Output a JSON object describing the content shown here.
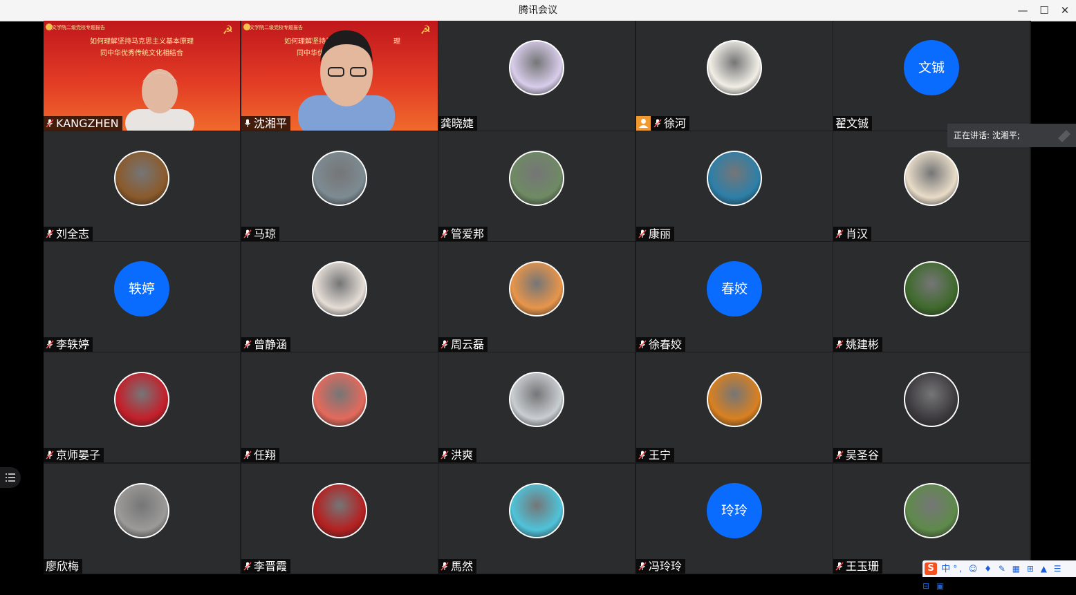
{
  "window": {
    "title": "腾讯会议",
    "controls": {
      "minimize": "—",
      "maximize": "☐",
      "close": "✕"
    }
  },
  "speaking": {
    "label": "正在讲话: 沈湘平;"
  },
  "slide": {
    "header": "文学院二级党校专题报告",
    "line1": "如何理解坚持马克思主义基本原理",
    "line2": "同中华优秀传统文化相结合",
    "line1_partial": "如何理解坚持马克",
    "line1_tail": "理",
    "line2_partial": "同中华优秀传"
  },
  "participants": [
    {
      "name": "KANGZHEN",
      "mic": "muted",
      "video": "slide"
    },
    {
      "name": "沈湘平",
      "mic": "on",
      "video": "slide"
    },
    {
      "name": "龚晓婕",
      "mic": "none",
      "avatar": "pastel-bird-illustration",
      "color": "#d8cdeb"
    },
    {
      "name": "徐河",
      "mic": "muted",
      "badge": "user-icon",
      "avatar": "cartoon-sprout-character",
      "color": "#f1eee6"
    },
    {
      "name": "翟文铖",
      "mic": "none",
      "avatar_text": "文铖"
    },
    {
      "name": "刘全志",
      "mic": "muted",
      "avatar": "horse-photo",
      "color": "#8b5a2b"
    },
    {
      "name": "马琼",
      "mic": "muted",
      "avatar": "mountain-portrait-photo",
      "color": "#7d8b92"
    },
    {
      "name": "管爱邦",
      "mic": "muted",
      "avatar": "river-boat-photo",
      "color": "#6f8a64"
    },
    {
      "name": "康丽",
      "mic": "muted",
      "avatar": "blue-art-figure",
      "color": "#2d7fa8"
    },
    {
      "name": "肖汉",
      "mic": "muted",
      "avatar": "anime-character",
      "color": "#e9dcc8"
    },
    {
      "name": "李轶婷",
      "mic": "muted",
      "avatar_text": "轶婷"
    },
    {
      "name": "曾静涵",
      "mic": "muted",
      "avatar": "woman-portrait",
      "color": "#e5ddd6"
    },
    {
      "name": "周云磊",
      "mic": "muted",
      "avatar": "cartoon-man-bookshelf",
      "color": "#e8954a"
    },
    {
      "name": "徐春姣",
      "mic": "muted",
      "avatar_text": "春姣"
    },
    {
      "name": "姚建彬",
      "mic": "muted",
      "avatar": "green-landscape-photo",
      "color": "#3f6a2c"
    },
    {
      "name": "京师晏子",
      "mic": "muted",
      "avatar": "red-lantern-poster",
      "color": "#c41f2a"
    },
    {
      "name": "任翔",
      "mic": "muted",
      "avatar": "sailboat-sunset",
      "color": "#e36a5c"
    },
    {
      "name": "洪爽",
      "mic": "muted",
      "avatar": "lighthouse-photo",
      "color": "#c9ced3"
    },
    {
      "name": "王宁",
      "mic": "muted",
      "avatar": "fire-explosion",
      "color": "#d98020"
    },
    {
      "name": "吴圣谷",
      "mic": "muted",
      "avatar": "man-portrait",
      "color": "#3d3a3e"
    },
    {
      "name": "廖欣梅",
      "mic": "none",
      "avatar": "woman-grayscale-photo",
      "color": "#9c9a98"
    },
    {
      "name": "李晋霞",
      "mic": "muted",
      "avatar": "red-black-artwork",
      "color": "#b52020"
    },
    {
      "name": "馬然",
      "mic": "muted",
      "avatar": "zebra-illustration",
      "color": "#4fc3d9"
    },
    {
      "name": "冯玲玲",
      "mic": "muted",
      "avatar_text": "玲玲"
    },
    {
      "name": "王玉珊",
      "mic": "muted",
      "avatar": "village-photo",
      "color": "#5e8a4a"
    }
  ],
  "ime": {
    "label": "中"
  }
}
